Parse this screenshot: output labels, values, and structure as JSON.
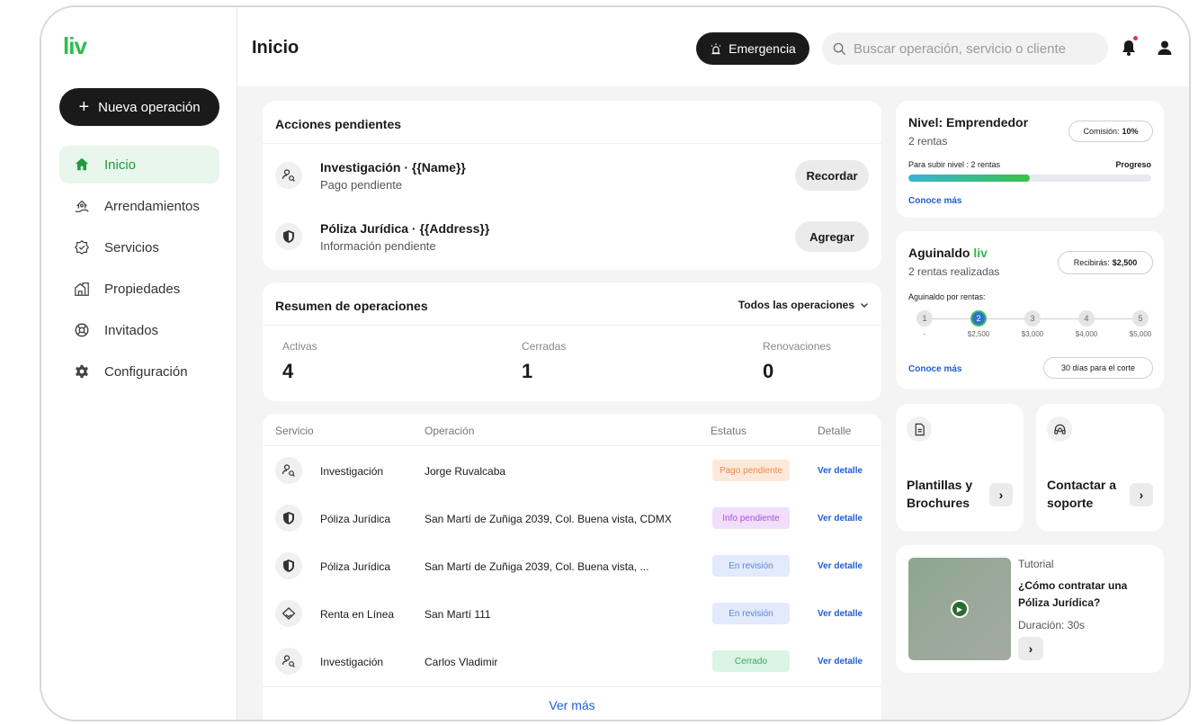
{
  "brand": {
    "logo": "liv",
    "accent": "#2ebd4e"
  },
  "sidebar": {
    "new_operation": "Nueva operación",
    "items": [
      {
        "label": "Inicio",
        "icon": "home-icon",
        "active": true
      },
      {
        "label": "Arrendamientos",
        "icon": "house-hand-icon"
      },
      {
        "label": "Servicios",
        "icon": "badge-check-icon"
      },
      {
        "label": "Propiedades",
        "icon": "building-icon"
      },
      {
        "label": "Invitados",
        "icon": "lifebuoy-icon"
      },
      {
        "label": "Configuración",
        "icon": "gear-icon"
      }
    ]
  },
  "header": {
    "title": "Inicio",
    "emergency": "Emergencia",
    "search_placeholder": "Buscar operación, servicio o cliente"
  },
  "pending": {
    "title": "Acciones pendientes",
    "items": [
      {
        "title": "Investigación · {{Name}}",
        "subtitle": "Pago pendiente",
        "action": "Recordar",
        "icon": "user-search-icon"
      },
      {
        "title": "Póliza Jurídica · {{Address}}",
        "subtitle": "Información pendiente",
        "action": "Agregar",
        "icon": "shield-icon"
      }
    ]
  },
  "summary": {
    "title": "Resumen de operaciones",
    "filter": "Todos las operaciones",
    "stats": [
      {
        "label": "Activas",
        "value": "4"
      },
      {
        "label": "Cerradas",
        "value": "1"
      },
      {
        "label": "Renovaciones",
        "value": "0"
      }
    ]
  },
  "table": {
    "headers": [
      "Servicio",
      "Operación",
      "Estatus",
      "Detalle"
    ],
    "rows": [
      {
        "service": "Investigación",
        "operation": "Jorge Ruvalcaba",
        "status": "Pago pendiente",
        "detail": "Ver detalle",
        "icon": "user-search-icon",
        "status_bg": "#fde9dc",
        "status_fg": "#e8894d"
      },
      {
        "service": "Póliza Jurídica",
        "operation": "San Martí de Zuñiga 2039, Col. Buena vista, CDMX",
        "status": "Info pendiente",
        "detail": "Ver detalle",
        "icon": "shield-icon",
        "status_bg": "#f1defb",
        "status_fg": "#a84fd8"
      },
      {
        "service": "Póliza Jurídica",
        "operation": "San Martí de Zuñiga 2039, Col. Buena vista, ...",
        "status": "En revisión",
        "detail": "Ver detalle",
        "icon": "shield-icon",
        "status_bg": "#e2eafb",
        "status_fg": "#5a86d8"
      },
      {
        "service": "Renta en Línea",
        "operation": "San Martí 111",
        "status": "En revisión",
        "detail": "Ver detalle",
        "icon": "house-outline-icon",
        "status_bg": "#e2eafb",
        "status_fg": "#5a86d8"
      },
      {
        "service": "Investigación",
        "operation": "Carlos Vladimir",
        "status": "Cerrado",
        "detail": "Ver detalle",
        "icon": "user-search-icon",
        "status_bg": "#daf5e3",
        "status_fg": "#37a95c"
      }
    ],
    "more": "Ver más"
  },
  "level": {
    "title": "Nivel: Emprendedor",
    "subtitle": "2 rentas",
    "commission_label": "Comisión:",
    "commission_value": "10%",
    "next_level": "Para subir nivel : 2 rentas",
    "progress_label": "Progreso",
    "progress": 0.5,
    "link": "Conoce más"
  },
  "aguinaldo": {
    "title": "Aguinaldo",
    "title_brand": "liv",
    "subtitle": "2 rentas realizadas",
    "receive_label": "Recibirás:",
    "receive_value": "$2,500",
    "by_rentas": "Aguinaldo por rentas:",
    "steps": [
      {
        "n": "1",
        "amount": "-"
      },
      {
        "n": "2",
        "amount": "$2,500",
        "active": true
      },
      {
        "n": "3",
        "amount": "$3,000"
      },
      {
        "n": "4",
        "amount": "$4,000"
      },
      {
        "n": "5",
        "amount": "$5,000"
      }
    ],
    "link": "Conoce más",
    "cutoff": "30 días para el corte"
  },
  "quick": {
    "templates": "Plantillas y Brochures",
    "support": "Contactar a soporte"
  },
  "tutorial": {
    "label": "Tutorial",
    "title": "¿Cómo contratar una Póliza Jurídica?",
    "duration": "Duración: 30s"
  }
}
